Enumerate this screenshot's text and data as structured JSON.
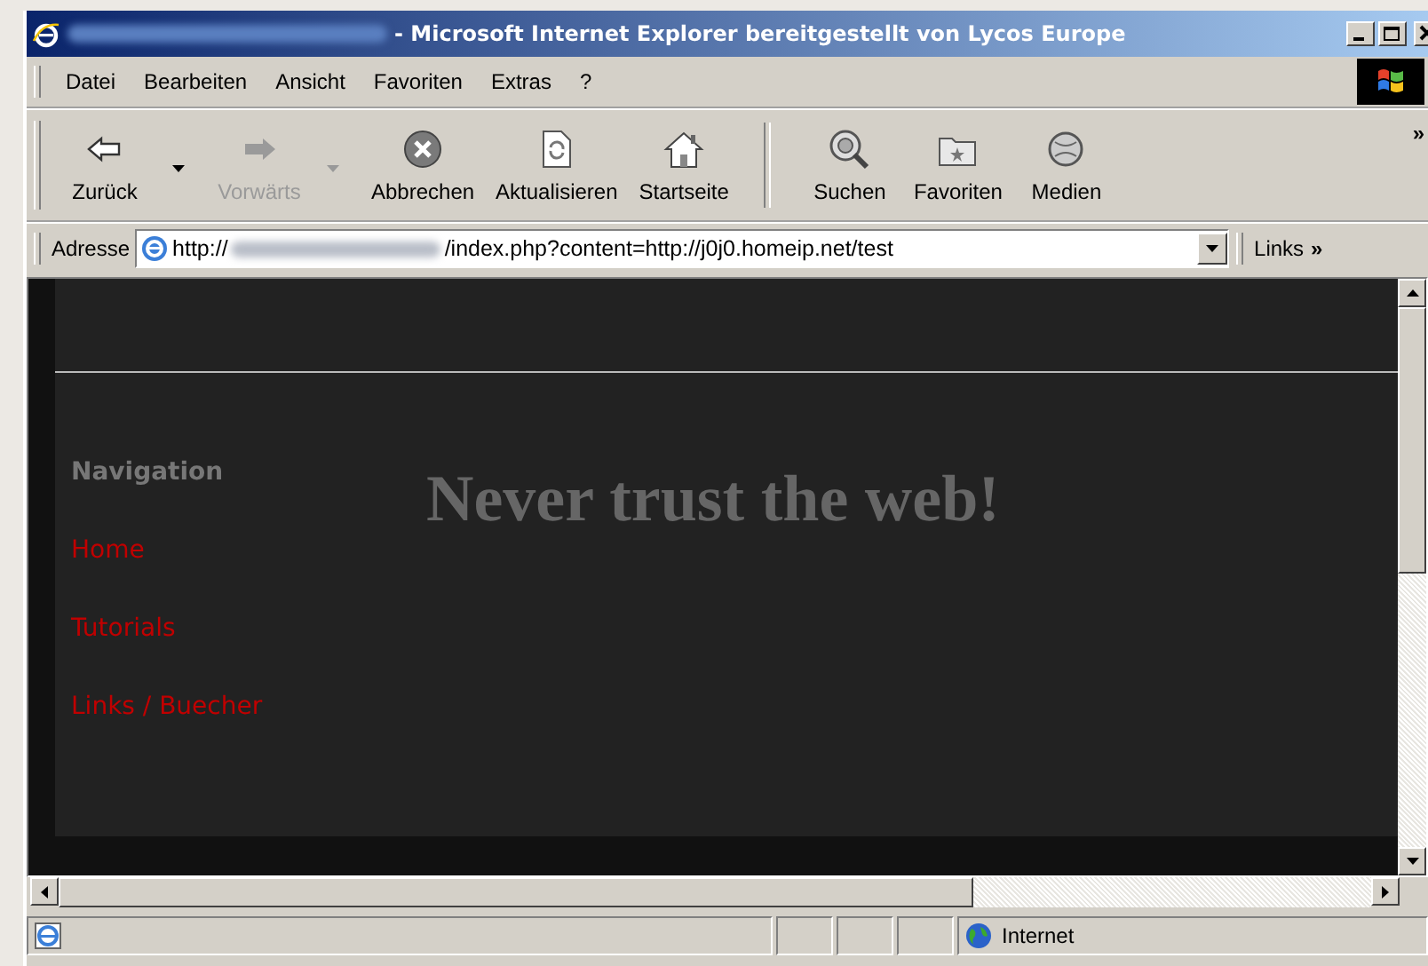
{
  "window": {
    "title": "- Microsoft Internet Explorer bereitgestellt von Lycos Europe"
  },
  "menu": [
    "Datei",
    "Bearbeiten",
    "Ansicht",
    "Favoriten",
    "Extras",
    "?"
  ],
  "toolbar": [
    {
      "kind": "back",
      "label": "Zurück",
      "disabled": false
    },
    {
      "kind": "dropdown",
      "disabled": false
    },
    {
      "kind": "forward",
      "label": "Vorwärts",
      "disabled": true
    },
    {
      "kind": "dropdown",
      "disabled": true
    },
    {
      "kind": "stop",
      "label": "Abbrechen",
      "disabled": false
    },
    {
      "kind": "refresh",
      "label": "Aktualisieren",
      "disabled": false
    },
    {
      "kind": "home",
      "label": "Startseite",
      "disabled": false
    },
    {
      "kind": "separator"
    },
    {
      "kind": "search",
      "label": "Suchen",
      "disabled": false
    },
    {
      "kind": "favorites",
      "label": "Favoriten",
      "disabled": false
    },
    {
      "kind": "media",
      "label": "Medien",
      "disabled": false
    }
  ],
  "toolbar_more": "»",
  "address_bar": {
    "label": "Adresse",
    "url_start": "http://",
    "url_end": "/index.php?content=http://j0j0.homeip.net/test",
    "links": "Links",
    "links_more": "»"
  },
  "page": {
    "navigation_heading": "Navigation",
    "nav_links": [
      "Home",
      "Tutorials",
      "Links / Buecher"
    ],
    "headline": "Never trust the web!"
  },
  "status_bar": {
    "zone": "Internet"
  }
}
